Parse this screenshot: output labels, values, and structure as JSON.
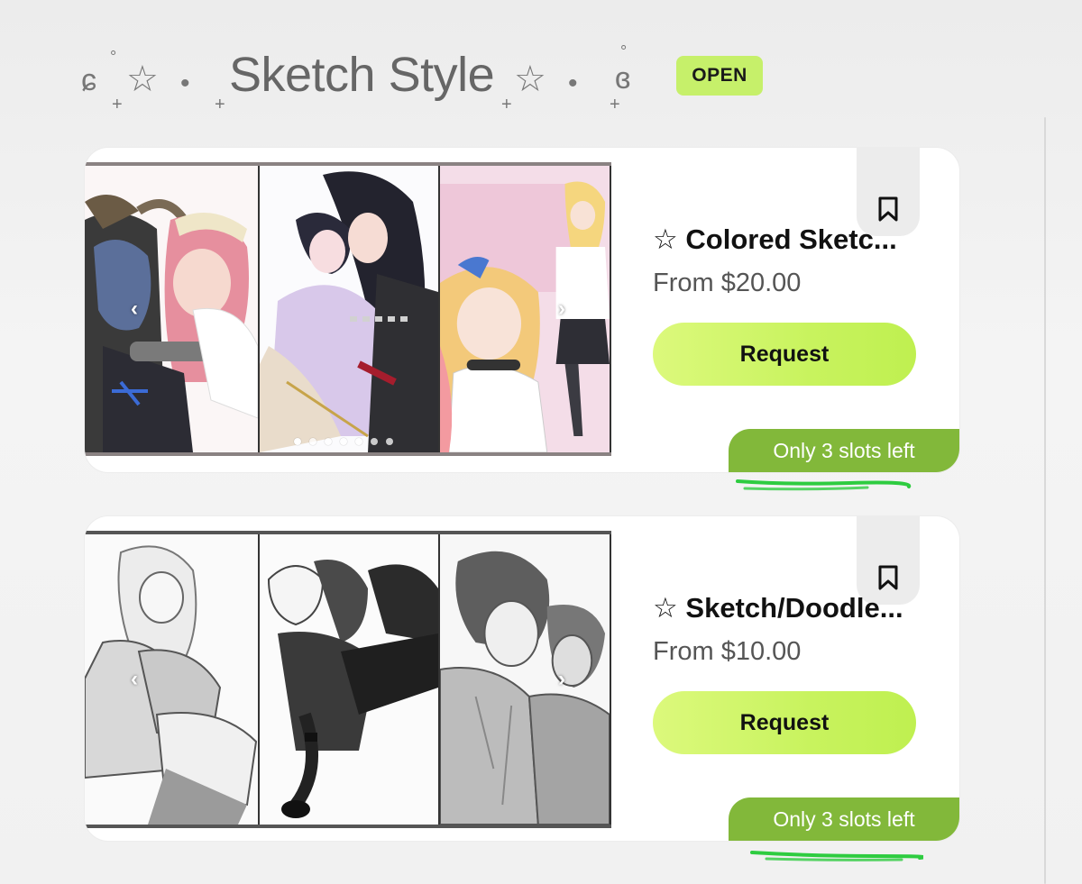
{
  "section": {
    "title": "꒰☆ • Sketch Style☆ • ꒱",
    "title_main": "Sketch Style",
    "status_badge": "OPEN"
  },
  "colors": {
    "accent_green": "#c6f06a",
    "badge_green": "#82b83a",
    "highlight_green": "#2ecc40"
  },
  "listings": [
    {
      "title": "☆ Colored Sketc...",
      "price": "From $20.00",
      "button_label": "Request",
      "slots_label": "Only 3 slots left",
      "bookmark_icon": "bookmark-icon",
      "gallery": {
        "panels": 3,
        "style": "color",
        "dots": 7,
        "active_dot": 0
      }
    },
    {
      "title": "☆ Sketch/Doodle...",
      "price": "From $10.00",
      "button_label": "Request",
      "slots_label": "Only 3 slots left",
      "bookmark_icon": "bookmark-icon",
      "gallery": {
        "panels": 3,
        "style": "grayscale",
        "dots": 0
      }
    }
  ]
}
